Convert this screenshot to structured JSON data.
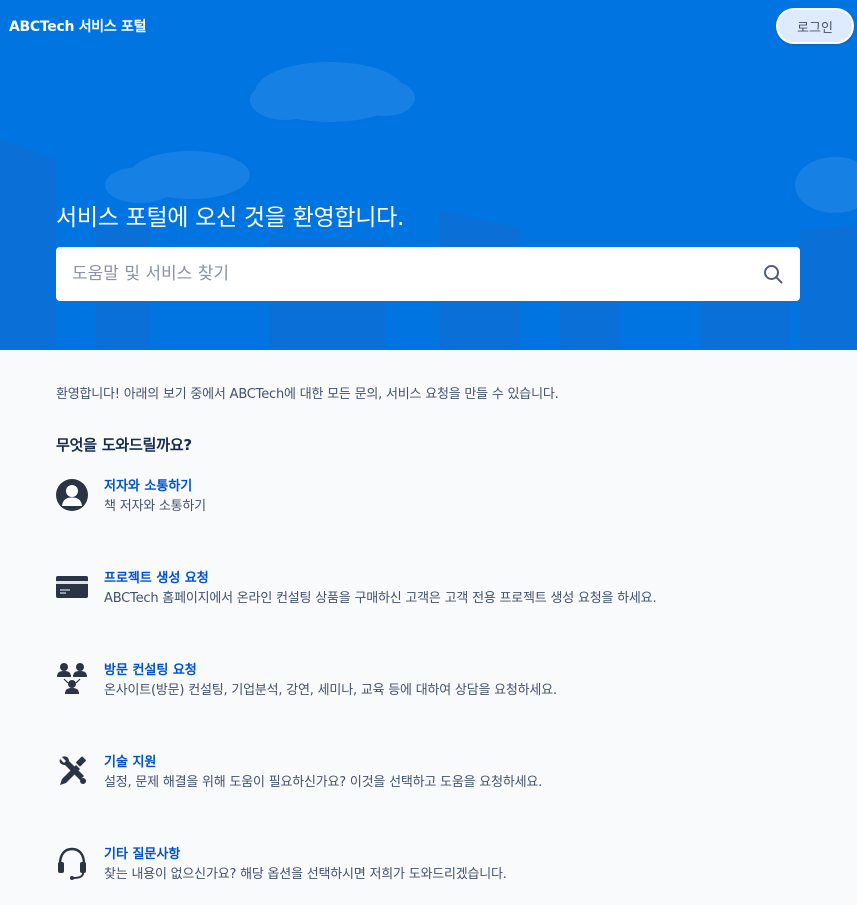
{
  "header": {
    "brand": "ABCTech 서비스 포털",
    "login_label": "로그인"
  },
  "hero": {
    "title": "서비스 포털에 오신 것을 환영합니다.",
    "search_placeholder": "도움말 및 서비스 찾기",
    "search_value": ""
  },
  "main": {
    "intro": "환영합니다! 아래의 보기 중에서 ABCTech에 대한 모든 문의, 서비스 요청을 만들 수 있습니다.",
    "section_title": "무엇을 도와드릴까요?",
    "items": [
      {
        "icon": "user-avatar-icon",
        "name": "저자와 소통하기",
        "desc": "책 저자와 소통하기"
      },
      {
        "icon": "credit-card-icon",
        "name": "프로젝트 생성 요청",
        "desc": "ABCTech 홈페이지에서 온라인 컨설팅 상품을 구매하신 고객은 고객 전용 프로젝트 생성 요청을 하세요."
      },
      {
        "icon": "people-network-icon",
        "name": "방문 컨설팅 요청",
        "desc": "온사이트(방문) 컨설팅, 기업분석, 강연, 세미나, 교육 등에 대하여 상담을 요청하세요."
      },
      {
        "icon": "tools-icon",
        "name": "기술 지원",
        "desc": "설정, 문제 해결을 위해 도움이 필요하신가요? 이것을 선택하고 도움을 요청하세요."
      },
      {
        "icon": "headset-icon",
        "name": "기타 질문사항",
        "desc": "찾는 내용이 없으신가요? 해당 옵션을 선택하시면 저희가 도와드리겠습니다."
      }
    ]
  },
  "colors": {
    "hero_blue": "#0074e0",
    "link_blue": "#0052cc",
    "text_dark": "#172b4d",
    "text_muted": "#42526e",
    "page_bg": "#f9fafc"
  }
}
